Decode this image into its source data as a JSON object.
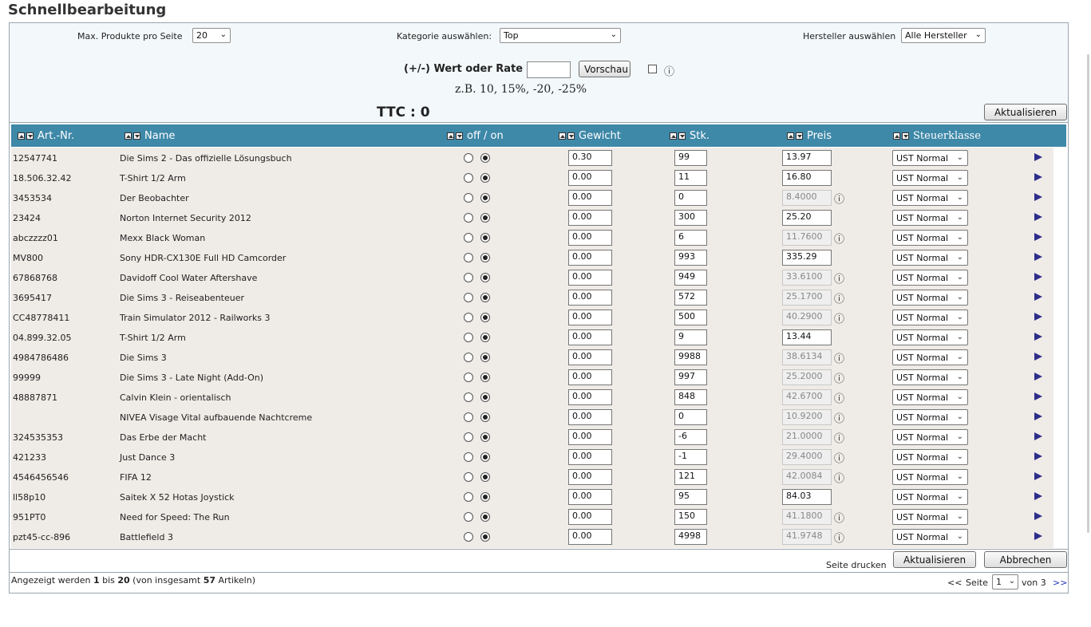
{
  "page_title": "Schnellbearbeitung",
  "filters": {
    "max_label": "Max. Produkte pro Seite",
    "max_value": "20",
    "category_label": "Kategorie auswählen:",
    "category_value": "Top",
    "manufacturer_label": "Hersteller auswählen",
    "manufacturer_value": "Alle Hersteller",
    "rate_label": "(+/-) Wert oder Rate :",
    "rate_value": "",
    "preview_button": "Vorschau",
    "info_icon": "i",
    "example": "z.B. 10, 15%, -20, -25%",
    "ttc": "TTC : 0",
    "update_button": "Aktualisieren"
  },
  "columns": {
    "art": "Art.-Nr.",
    "name": "Name",
    "status": "off / on",
    "weight": "Gewicht",
    "qty": "Stk.",
    "price": "Preis",
    "tax": "Steuerklasse"
  },
  "rows": [
    {
      "art": "12547741",
      "name": "Die Sims 2 - Das offizielle Lösungsbuch",
      "weight": "0.30",
      "qty": "99",
      "price": "13.97",
      "price_disabled": false,
      "tax": "UST Normal"
    },
    {
      "art": "18.506.32.42",
      "name": "T-Shirt 1/2 Arm",
      "weight": "0.00",
      "qty": "11",
      "price": "16.80",
      "price_disabled": false,
      "tax": "UST Normal"
    },
    {
      "art": "3453534",
      "name": "Der Beobachter",
      "weight": "0.00",
      "qty": "0",
      "price": "8.4000",
      "price_disabled": true,
      "tax": "UST Normal"
    },
    {
      "art": "23424",
      "name": "Norton Internet Security 2012",
      "weight": "0.00",
      "qty": "300",
      "price": "25.20",
      "price_disabled": false,
      "tax": "UST Normal"
    },
    {
      "art": "abczzzz01",
      "name": "Mexx Black Woman",
      "weight": "0.00",
      "qty": "6",
      "price": "11.7600",
      "price_disabled": true,
      "tax": "UST Normal"
    },
    {
      "art": "MV800",
      "name": "Sony HDR-CX130E Full HD Camcorder",
      "weight": "0.00",
      "qty": "993",
      "price": "335.29",
      "price_disabled": false,
      "tax": "UST Normal"
    },
    {
      "art": "67868768",
      "name": "Davidoff Cool Water Aftershave",
      "weight": "0.00",
      "qty": "949",
      "price": "33.6100",
      "price_disabled": true,
      "tax": "UST Normal"
    },
    {
      "art": "3695417",
      "name": "Die Sims 3 - Reiseabenteuer",
      "weight": "0.00",
      "qty": "572",
      "price": "25.1700",
      "price_disabled": true,
      "tax": "UST Normal"
    },
    {
      "art": "CC48778411",
      "name": "Train Simulator 2012 - Railworks 3",
      "weight": "0.00",
      "qty": "500",
      "price": "40.2900",
      "price_disabled": true,
      "tax": "UST Normal"
    },
    {
      "art": "04.899.32.05",
      "name": "T-Shirt 1/2 Arm",
      "weight": "0.00",
      "qty": "9",
      "price": "13.44",
      "price_disabled": false,
      "tax": "UST Normal"
    },
    {
      "art": "4984786486",
      "name": "Die Sims 3",
      "weight": "0.00",
      "qty": "9988",
      "price": "38.6134",
      "price_disabled": true,
      "tax": "UST Normal"
    },
    {
      "art": "99999",
      "name": "Die Sims 3 - Late Night (Add-On)",
      "weight": "0.00",
      "qty": "997",
      "price": "25.2000",
      "price_disabled": true,
      "tax": "UST Normal"
    },
    {
      "art": "48887871",
      "name": "Calvin Klein - orientalisch",
      "weight": "0.00",
      "qty": "848",
      "price": "42.6700",
      "price_disabled": true,
      "tax": "UST Normal"
    },
    {
      "art": "",
      "name": "NIVEA Visage Vital aufbauende Nachtcreme",
      "weight": "0.00",
      "qty": "0",
      "price": "10.9200",
      "price_disabled": true,
      "tax": "UST Normal"
    },
    {
      "art": "324535353",
      "name": "Das Erbe der Macht",
      "weight": "0.00",
      "qty": "-6",
      "price": "21.0000",
      "price_disabled": true,
      "tax": "UST Normal"
    },
    {
      "art": "421233",
      "name": "Just Dance 3",
      "weight": "0.00",
      "qty": "-1",
      "price": "29.4000",
      "price_disabled": true,
      "tax": "UST Normal"
    },
    {
      "art": "4546456546",
      "name": "FIFA 12",
      "weight": "0.00",
      "qty": "121",
      "price": "42.0084",
      "price_disabled": true,
      "tax": "UST Normal"
    },
    {
      "art": "ll58p10",
      "name": "Saitek X 52 Hotas Joystick",
      "weight": "0.00",
      "qty": "95",
      "price": "84.03",
      "price_disabled": false,
      "tax": "UST Normal"
    },
    {
      "art": "951PT0",
      "name": "Need for Speed: The Run",
      "weight": "0.00",
      "qty": "150",
      "price": "41.1800",
      "price_disabled": true,
      "tax": "UST Normal"
    },
    {
      "art": "pzt45-cc-896",
      "name": "Battlefield 3",
      "weight": "0.00",
      "qty": "4998",
      "price": "41.9748",
      "price_disabled": true,
      "tax": "UST Normal"
    }
  ],
  "footer": {
    "print_label": "Seite drucken",
    "update_button": "Aktualisieren",
    "cancel_button": "Abbrechen",
    "count_prefix": "Angezeigt werden ",
    "count_from": "1",
    "count_mid": " bis ",
    "count_to": "20",
    "count_mid2": " (von insgesamt ",
    "count_total": "57",
    "count_suffix": " Artikeln)",
    "prev": "<<",
    "page_label": "Seite",
    "page_value": "1",
    "of_label": "von 3",
    "next": ">>"
  }
}
